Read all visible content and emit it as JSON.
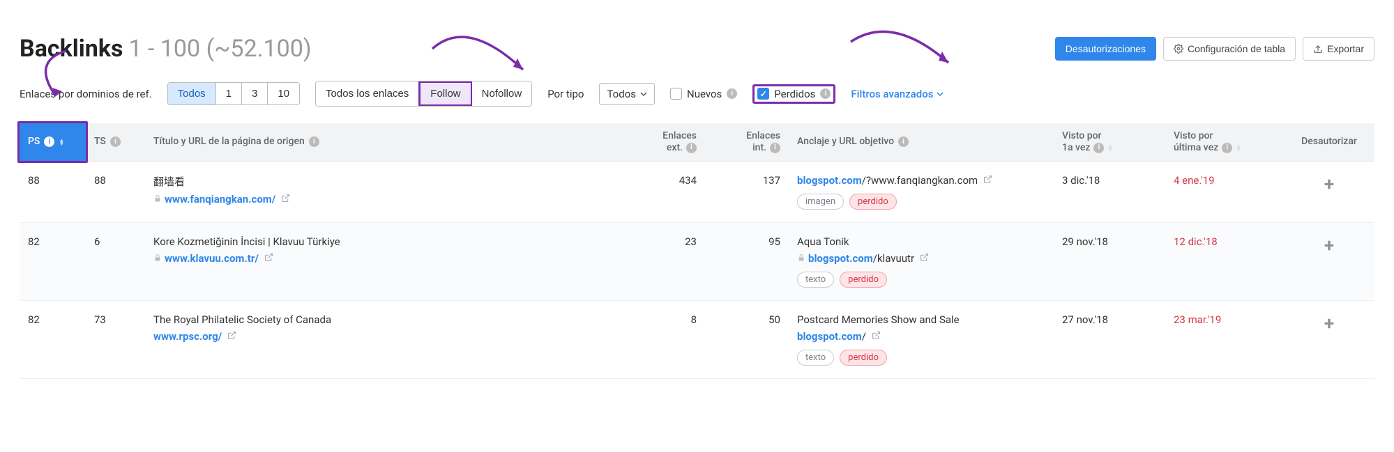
{
  "header": {
    "title": "Backlinks",
    "range": "1 - 100 (~52.100)",
    "btn_disavow": "Desautorizaciones",
    "btn_config": "Configuración de tabla",
    "btn_export": "Exportar"
  },
  "filters": {
    "ref_label": "Enlaces por dominios de ref.",
    "ref_opts": [
      "Todos",
      "1",
      "3",
      "10"
    ],
    "ref_active": "Todos",
    "link_opts": [
      "Todos los enlaces",
      "Follow",
      "Nofollow"
    ],
    "link_active": "Follow",
    "type_label": "Por tipo",
    "type_sel": "Todos",
    "new_label": "Nuevos",
    "lost_label": "Perdidos",
    "adv_label": "Filtros avanzados"
  },
  "columns": {
    "ps": "PS",
    "ts": "TS",
    "title": "Título y URL de la página de origen",
    "ext_l1": "Enlaces",
    "ext_l2": "ext.",
    "int_l1": "Enlaces",
    "int_l2": "int.",
    "anchor": "Anclaje y URL objetivo",
    "first_l1": "Visto por",
    "first_l2": "1a vez",
    "last_l1": "Visto por",
    "last_l2": "última vez",
    "dis": "Desautorizar"
  },
  "tags": {
    "image": "imagen",
    "text": "texto",
    "lost": "perdido"
  },
  "rows": [
    {
      "ps": "88",
      "ts": "88",
      "title": "翻墙看",
      "url_pre": "",
      "url": "www.fanqiangkan.com/",
      "lock": true,
      "ext": "434",
      "int": "137",
      "anchor_title": "",
      "anchor_url_pre": "blogspot.com",
      "anchor_url_post": "/?www.fanqiangkan.com",
      "anchor_lock": false,
      "tag_type": "image",
      "first": "3 dic.'18",
      "last": "4 ene.'19"
    },
    {
      "ps": "82",
      "ts": "6",
      "title": "Kore Kozmetiğinin İncisi | Klavuu Türkiye",
      "url_pre": "",
      "url": "www.klavuu.com.tr/",
      "lock": true,
      "ext": "23",
      "int": "95",
      "anchor_title": "Aqua Tonik",
      "anchor_url_pre": "blogspot.com",
      "anchor_url_post": "/klavuutr",
      "anchor_lock": true,
      "tag_type": "text",
      "first": "29 nov.'18",
      "last": "12 dic.'18"
    },
    {
      "ps": "82",
      "ts": "73",
      "title": "The Royal Philatelic Society of Canada",
      "url_pre": "",
      "url": "www.rpsc.org/",
      "lock": false,
      "ext": "8",
      "int": "50",
      "anchor_title": "Postcard Memories Show and Sale",
      "anchor_url_pre": "blogspot.com",
      "anchor_url_post": "/",
      "anchor_lock": false,
      "tag_type": "text",
      "first": "27 nov.'18",
      "last": "23 mar.'19"
    }
  ]
}
